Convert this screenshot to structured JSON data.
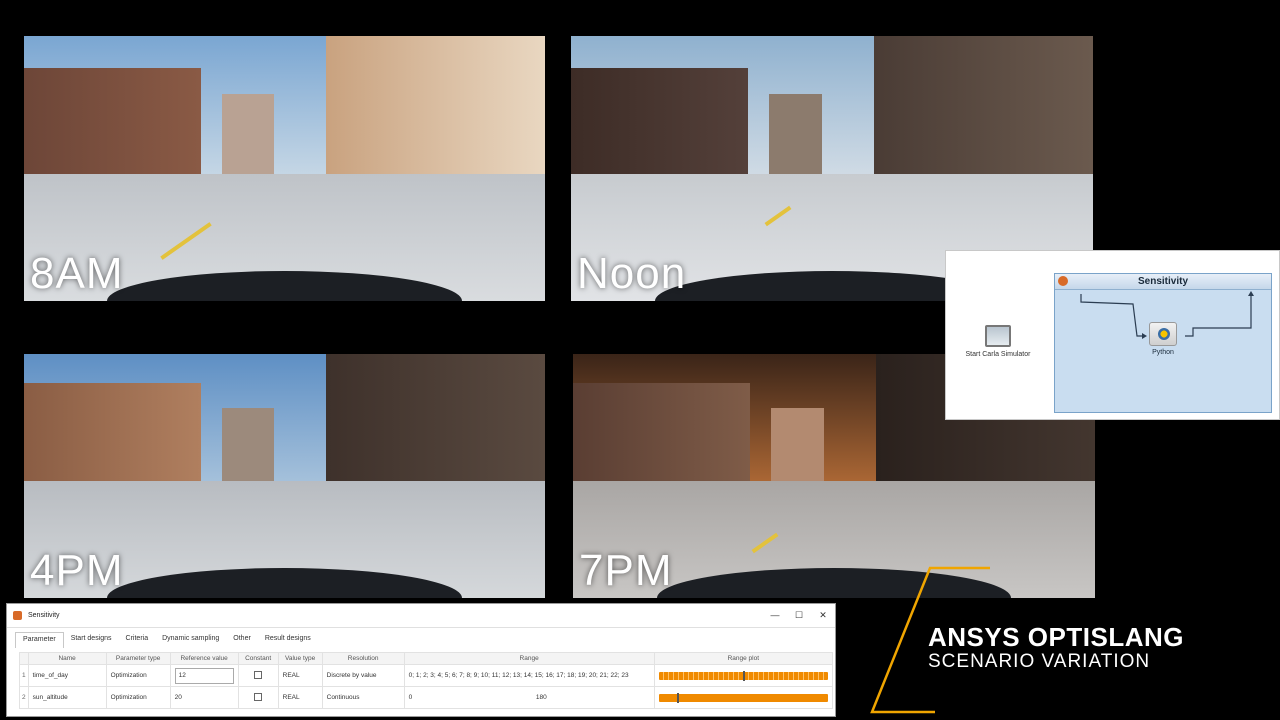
{
  "scenes": [
    {
      "label": "8AM"
    },
    {
      "label": "Noon"
    },
    {
      "label": "4PM"
    },
    {
      "label": "7PM"
    }
  ],
  "workflow": {
    "start_node_label": "Start Carla Simulator",
    "system_title": "Sensitivity",
    "python_node_label": "Python"
  },
  "dialog": {
    "title": "Sensitivity",
    "controls": [
      "—",
      "☐",
      "✕"
    ],
    "tabs": [
      "Parameter",
      "Start designs",
      "Criteria",
      "Dynamic sampling",
      "Other",
      "Result designs"
    ],
    "active_tab": "Parameter",
    "columns": [
      "",
      "Name",
      "Parameter type",
      "Reference value",
      "Constant",
      "Value type",
      "Resolution",
      "Range",
      "Range plot"
    ],
    "rows": [
      {
        "num": "1",
        "name": "time_of_day",
        "parameter_type": "Optimization",
        "reference_value": "12",
        "value_type": "REAL",
        "resolution": "Discrete by value",
        "range": "0; 1; 2; 3; 4; 5; 6; 7; 8; 9; 10; 11; 12; 13; 14; 15; 16; 17; 18; 19; 20; 21; 22; 23",
        "range_min": "",
        "range_max": "",
        "marker_fraction": 0.5
      },
      {
        "num": "2",
        "name": "sun_altitude",
        "parameter_type": "Optimization",
        "reference_value": "20",
        "value_type": "REAL",
        "resolution": "Continuous",
        "range": "",
        "range_min": "0",
        "range_max": "180",
        "marker_fraction": 0.11
      }
    ]
  },
  "brand": {
    "line1": "ANSYS OPTISLANG",
    "line2": "SCENARIO VARIATION",
    "accent_color": "#f0a500"
  }
}
